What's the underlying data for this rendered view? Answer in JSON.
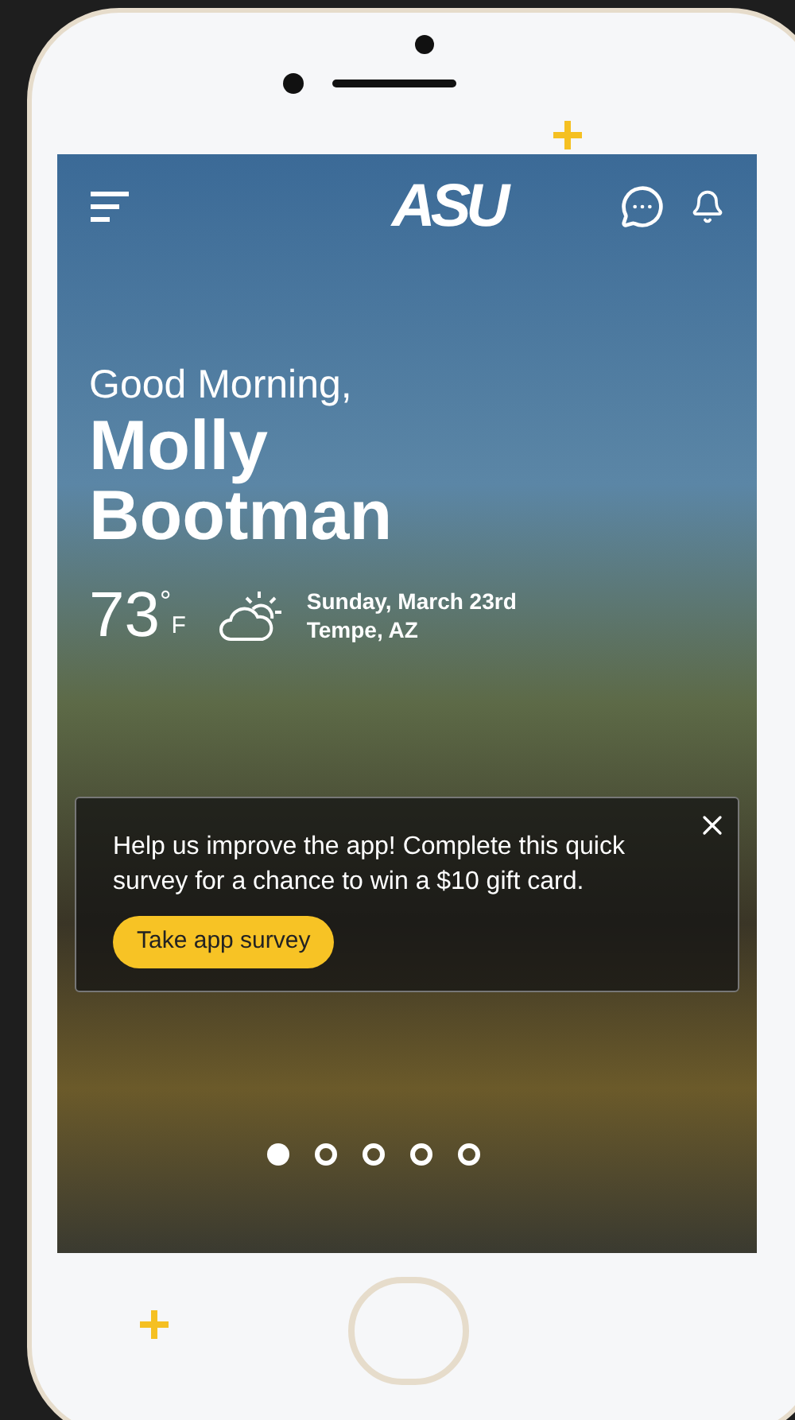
{
  "header": {
    "logo": "ASU"
  },
  "greeting": "Good Morning,",
  "name": "Molly Bootman",
  "weather": {
    "temperature": "73",
    "degree": "°",
    "unit": "F",
    "date": "Sunday, March 23rd",
    "location": "Tempe, AZ"
  },
  "survey": {
    "message": "Help us improve the app! Complete this quick survey for a chance to win a $10 gift card.",
    "button": "Take app survey"
  },
  "carousel": [
    {
      "selected": true
    },
    {
      "selected": false
    },
    {
      "selected": false
    },
    {
      "selected": false
    },
    {
      "selected": false
    }
  ]
}
